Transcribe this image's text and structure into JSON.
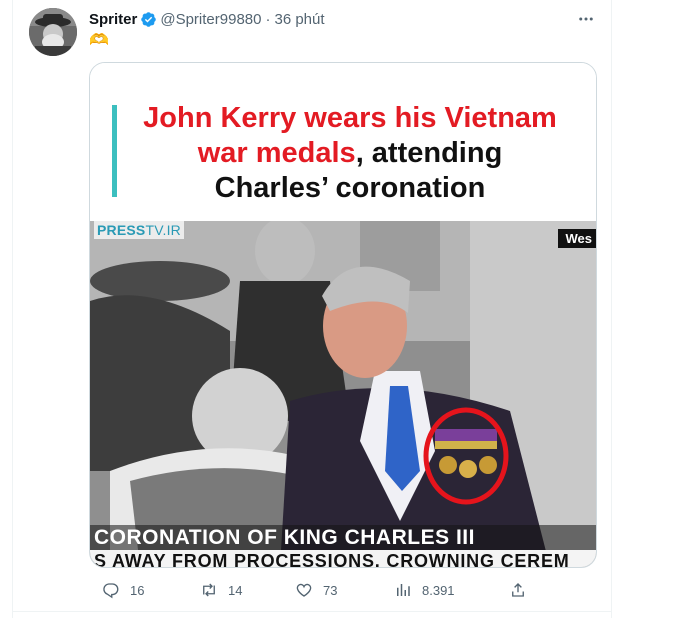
{
  "tweet": {
    "author_name": "Spriter",
    "handle": "@Spriter99880",
    "separator": "·",
    "time": "36 phút",
    "body_emoji": "🫶"
  },
  "media": {
    "headline_red_1": "John Kerry wears his Vietnam",
    "headline_red_2": "war medals",
    "headline_black_2": ", attending",
    "headline_black_3": "Charles’ coronation",
    "logo_press": "PRESS",
    "logo_tv": "TV.IR",
    "corner_tag": "Wes",
    "lower_third": "CORONATION OF KING CHARLES III",
    "ticker": "S AWAY FROM PROCESSIONS, CROWNING CEREM"
  },
  "actions": {
    "reply_count": "16",
    "retweet_count": "14",
    "like_count": "73",
    "view_count": "8.391"
  },
  "colors": {
    "verified": "#1d9bf0",
    "headline_red": "#e31b23",
    "headline_bar": "#3cbfbf",
    "muted": "#536471"
  },
  "icons": [
    "verified-badge-icon",
    "more-icon",
    "reply-icon",
    "retweet-icon",
    "like-icon",
    "views-icon",
    "share-icon"
  ]
}
